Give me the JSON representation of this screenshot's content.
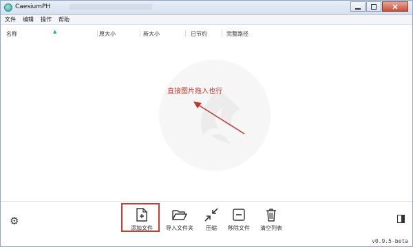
{
  "window": {
    "title": "CaesiumPH"
  },
  "menu": [
    "文件",
    "编辑",
    "操作",
    "帮助"
  ],
  "table": {
    "columns": [
      "名称",
      "原大小",
      "新大小",
      "已节约",
      "完整路径"
    ]
  },
  "hint": {
    "text": "直接图片拖入也行",
    "color": "#c0392b"
  },
  "toolbar": {
    "buttons": [
      {
        "label": "添加文件",
        "icon": "add-file-icon"
      },
      {
        "label": "导入文件夹",
        "icon": "folder-open-icon"
      },
      {
        "label": "压缩",
        "icon": "compress-icon"
      },
      {
        "label": "移除文件",
        "icon": "remove-icon"
      },
      {
        "label": "清空列表",
        "icon": "trash-icon"
      }
    ]
  },
  "version": "v0.9.5-beta",
  "colors": {
    "accent": "#2fa79b",
    "highlight": "#d23a2e"
  }
}
